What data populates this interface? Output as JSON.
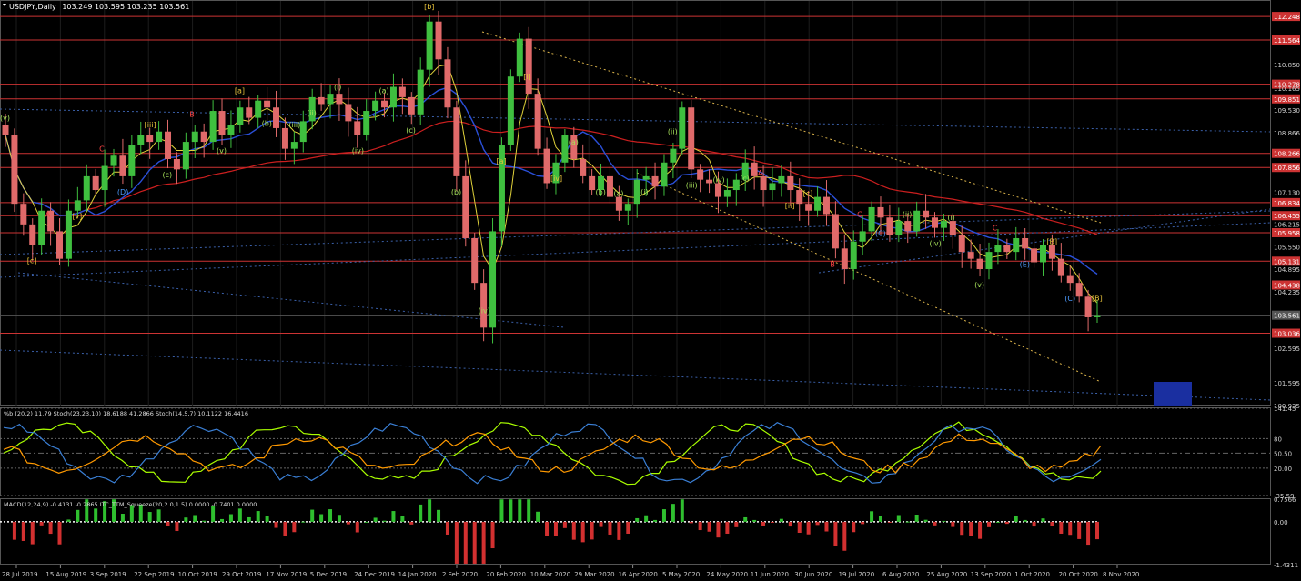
{
  "header": {
    "symbol": "USDJPY,Daily",
    "ohlc": "103.249 103.595 103.235 103.561"
  },
  "chart_data": [
    {
      "type": "line",
      "title": "USDJPY,Daily",
      "ylim": [
        100.935,
        112.7
      ],
      "right_axis_labels": [
        112.248,
        111.564,
        110.85,
        110.278,
        110.165,
        109.851,
        109.53,
        108.866,
        108.266,
        107.856,
        107.13,
        106.834,
        106.455,
        106.215,
        105.958,
        105.55,
        105.131,
        104.895,
        104.438,
        104.235,
        103.561,
        103.036,
        102.595,
        101.595,
        100.935
      ],
      "levels": [
        {
          "label": "112.248",
          "value": 112.248,
          "color": "#cc3333"
        },
        {
          "label": "111.564",
          "value": 111.564,
          "color": "#cc3333"
        },
        {
          "label": "110.278",
          "value": 110.278,
          "color": "#cc3333"
        },
        {
          "label": "109.851",
          "value": 109.851,
          "color": "#cc3333"
        },
        {
          "label": "108.266",
          "value": 108.266,
          "color": "#cc3333"
        },
        {
          "label": "107.856",
          "value": 107.856,
          "color": "#cc3333"
        },
        {
          "label": "106.834",
          "value": 106.834,
          "color": "#cc3333"
        },
        {
          "label": "106.455",
          "value": 106.455,
          "color": "#cc3333"
        },
        {
          "label": "105.958",
          "value": 105.958,
          "color": "#cc3333"
        },
        {
          "label": "105.131",
          "value": 105.131,
          "color": "#cc3333"
        },
        {
          "label": "104.438",
          "value": 104.438,
          "color": "#cc3333"
        },
        {
          "label": "103.036",
          "value": 103.036,
          "color": "#cc3333"
        },
        {
          "label": "103.561",
          "value": 103.561,
          "color": "#555555"
        }
      ],
      "x_tick_labels": [
        "28 Jul 2019",
        "15 Aug 2019",
        "3 Sep 2019",
        "22 Sep 2019",
        "10 Oct 2019",
        "29 Oct 2019",
        "17 Nov 2019",
        "5 Dec 2019",
        "24 Dec 2019",
        "14 Jan 2020",
        "2 Feb 2020",
        "20 Feb 2020",
        "10 Mar 2020",
        "29 Mar 2020",
        "16 Apr 2020",
        "5 May 2020",
        "24 May 2020",
        "11 Jun 2020",
        "30 Jun 2020",
        "19 Jul 2020",
        "6 Aug 2020",
        "25 Aug 2020",
        "13 Sep 2020",
        "1 Oct 2020",
        "20 Oct 2020",
        "8 Nov 2020"
      ],
      "closes": [
        108.8,
        106.8,
        106.2,
        105.6,
        106.6,
        106.0,
        105.2,
        106.6,
        106.9,
        107.6,
        107.2,
        107.9,
        108.2,
        107.6,
        108.5,
        108.8,
        108.6,
        108.9,
        108.1,
        107.8,
        108.6,
        108.9,
        108.6,
        109.5,
        108.8,
        109.1,
        109.6,
        109.3,
        109.8,
        109.6,
        109.0,
        108.4,
        108.6,
        109.2,
        109.9,
        109.7,
        110.0,
        109.7,
        109.2,
        108.8,
        109.5,
        109.8,
        109.6,
        110.2,
        109.9,
        109.4,
        110.7,
        112.1,
        111.0,
        109.6,
        107.6,
        105.8,
        104.5,
        103.2,
        106.0,
        108.5,
        110.5,
        111.6,
        110.0,
        108.4,
        107.4,
        108.0,
        108.8,
        108.1,
        107.6,
        107.2,
        107.6,
        107.0,
        106.6,
        106.8,
        107.5,
        107.6,
        107.3,
        108.0,
        108.4,
        109.6,
        107.8,
        107.5,
        107.4,
        107.0,
        107.2,
        107.5,
        108.0,
        107.6,
        107.2,
        107.4,
        107.6,
        107.2,
        106.8,
        106.6,
        107.0,
        106.5,
        105.5,
        104.9,
        105.7,
        106.0,
        106.7,
        106.4,
        105.9,
        106.3,
        106.0,
        106.6,
        106.4,
        106.1,
        106.3,
        105.9,
        105.4,
        105.2,
        104.9,
        105.4,
        105.6,
        105.4,
        105.8,
        105.5,
        105.1,
        105.6,
        105.2,
        104.7,
        104.5,
        104.1,
        103.5,
        103.561
      ],
      "wave_labels": [
        "(v)",
        "[c]",
        "A",
        "[v]",
        "C",
        "(D)",
        "[iii]",
        "(c)",
        "B",
        "(v)",
        "[a]",
        "(b)",
        "(iii)",
        "(ii)",
        "(i)",
        "(iv)",
        "(a)",
        "(c)",
        "[b]",
        "(b)",
        "(iv)",
        "[a]",
        "[i]",
        "[iv]",
        "(a)",
        "(b)",
        "(a)",
        "(i)",
        "(ii)",
        "(iii)",
        "(iv)",
        "(c)",
        "A",
        "[ii]",
        "[c]",
        "B",
        "C",
        "(C)",
        "(ii)",
        "(iv)",
        "(i)",
        "(v)",
        "C",
        "(E)",
        "[B]",
        "(C)",
        "[B]"
      ]
    },
    {
      "type": "line",
      "title": "%b (20,2) 11.79 Stoch(23,23,10) 18.6188 41.2866 Stoch(14,5,7) 10.1122 16.4416",
      "right_axis_labels": [
        141.45,
        80,
        50.5,
        20.0,
        -35.59
      ],
      "series": [
        {
          "name": "%b (20,2)",
          "color": "#aaff00"
        },
        {
          "name": "Stoch(23,23,10)",
          "color": "#3a7fd5"
        },
        {
          "name": "Stoch(14,5,7)",
          "color": "#ff9900"
        }
      ]
    },
    {
      "type": "bar",
      "title": "MACD(12,24,9) -0.4131 -0.2865 ITC_TTM_Squeeze(20,2.0,1.5) 0.0000 -0.7401 0.0000",
      "right_axis_labels": [
        0.7566,
        0.0,
        -1.4311
      ]
    }
  ]
}
